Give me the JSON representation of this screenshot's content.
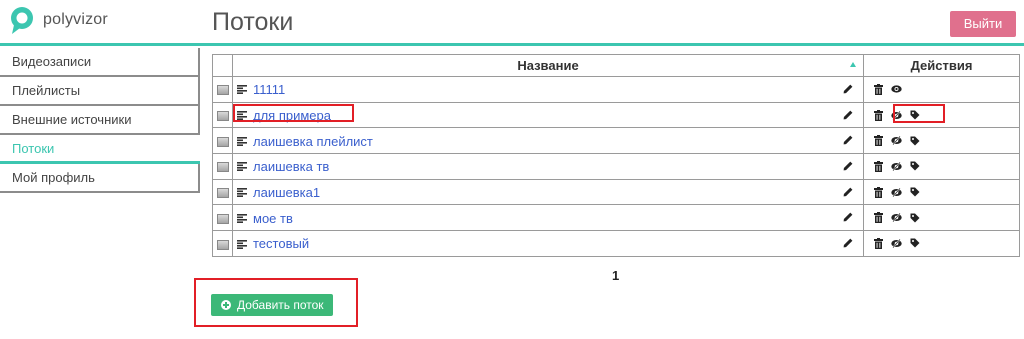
{
  "brand": {
    "name": "polyvizor",
    "accent": "#3cc6b0",
    "logout_color": "#e0708d",
    "add_color": "#3cb878",
    "link_color": "#3a5fcd",
    "highlight": "#e21f26"
  },
  "header": {
    "title": "Потоки",
    "logout_label": "Выйти"
  },
  "sidebar": {
    "items": [
      {
        "label": "Видеозаписи",
        "active": false
      },
      {
        "label": "Плейлисты",
        "active": false
      },
      {
        "label": "Внешние источники",
        "active": false
      },
      {
        "label": "Потоки",
        "active": true
      },
      {
        "label": "Мой профиль",
        "active": false
      }
    ]
  },
  "table": {
    "headers": {
      "name": "Название",
      "actions": "Действия"
    },
    "rows": [
      {
        "name": "11111",
        "actions": [
          "trash-icon",
          "eye-icon"
        ]
      },
      {
        "name": "для примера",
        "actions": [
          "trash-icon",
          "eye-slash-icon",
          "tag-icon"
        ]
      },
      {
        "name": "лаишевка плейлист",
        "actions": [
          "trash-icon",
          "eye-slash-icon",
          "tag-icon"
        ]
      },
      {
        "name": "лаишевка тв",
        "actions": [
          "trash-icon",
          "eye-slash-icon",
          "tag-icon"
        ]
      },
      {
        "name": "лаишевка1",
        "actions": [
          "trash-icon",
          "eye-slash-icon",
          "tag-icon"
        ]
      },
      {
        "name": "мое тв",
        "actions": [
          "trash-icon",
          "eye-slash-icon",
          "tag-icon"
        ]
      },
      {
        "name": "тестовый",
        "actions": [
          "trash-icon",
          "eye-slash-icon",
          "tag-icon"
        ]
      }
    ]
  },
  "pagination": {
    "current": "1"
  },
  "add_stream": {
    "label": "Добавить поток"
  }
}
